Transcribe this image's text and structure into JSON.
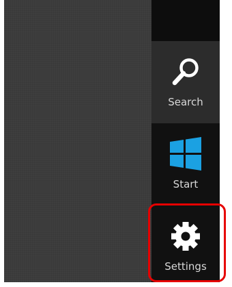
{
  "charms": {
    "search": {
      "label": "Search",
      "icon": "search-icon"
    },
    "start": {
      "label": "Start",
      "icon": "windows-logo-icon",
      "accent": "#1ba1e2"
    },
    "settings": {
      "label": "Settings",
      "icon": "gear-icon"
    }
  },
  "colors": {
    "desktop_bg": "#3a3a3a",
    "charms_bg": "#111111",
    "search_bg": "#2c2c2c",
    "highlight": "#e60000"
  }
}
